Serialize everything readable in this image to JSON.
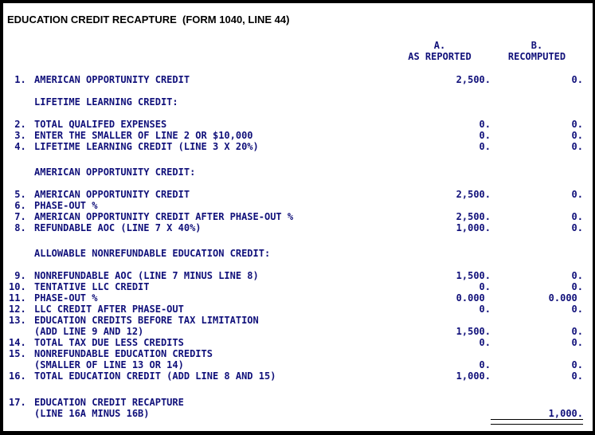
{
  "title": "EDUCATION CREDIT RECAPTURE  (FORM 1040, LINE 44)",
  "columns": {
    "a_letter": "A.",
    "a_label": "AS REPORTED",
    "b_letter": "B.",
    "b_label": "RECOMPUTED"
  },
  "rows": [
    {
      "num": " 1.",
      "label": "AMERICAN OPPORTUNITY CREDIT",
      "a": "2,500.",
      "b": "0."
    },
    {
      "num": "",
      "label": "LIFETIME LEARNING CREDIT:",
      "a": "",
      "b": ""
    },
    {
      "num": " 2.",
      "label": "TOTAL QUALIFED EXPENSES",
      "a": "0.",
      "b": "0."
    },
    {
      "num": " 3.",
      "label": "ENTER THE SMALLER OF LINE 2 OR $10,000",
      "a": "0.",
      "b": "0."
    },
    {
      "num": " 4.",
      "label": "LIFETIME LEARNING CREDIT (LINE 3 X 20%)",
      "a": "0.",
      "b": "0."
    },
    {
      "num": "",
      "label": "AMERICAN OPPORTUNITY CREDIT:",
      "a": "",
      "b": ""
    },
    {
      "num": " 5.",
      "label": "AMERICAN OPPORTUNITY CREDIT",
      "a": "2,500.",
      "b": "0."
    },
    {
      "num": " 6.",
      "label": "PHASE-OUT %",
      "a": "",
      "b": ""
    },
    {
      "num": " 7.",
      "label": "AMERICAN OPPORTUNITY CREDIT AFTER PHASE-OUT %",
      "a": "2,500.",
      "b": "0."
    },
    {
      "num": " 8.",
      "label": "REFUNDABLE AOC (LINE 7 X 40%)",
      "a": "1,000.",
      "b": "0."
    },
    {
      "num": "",
      "label": "ALLOWABLE NONREFUNDABLE EDUCATION CREDIT:",
      "a": "",
      "b": ""
    },
    {
      "num": " 9.",
      "label": "NONREFUNDABLE AOC (LINE 7 MINUS LINE 8)",
      "a": "1,500.",
      "b": "0."
    },
    {
      "num": "10.",
      "label": "TENTATIVE LLC CREDIT",
      "a": "0.",
      "b": "0."
    },
    {
      "num": "11.",
      "label": "PHASE-OUT %",
      "a": "0.000 ",
      "b": "0.000 "
    },
    {
      "num": "12.",
      "label": "LLC CREDIT AFTER PHASE-OUT",
      "a": "0.",
      "b": "0."
    },
    {
      "num": "13.",
      "label": "EDUCATION CREDITS BEFORE TAX LIMITATION",
      "a": "",
      "b": ""
    },
    {
      "num": "",
      "label": "(ADD LINE 9 AND 12)",
      "a": "1,500.",
      "b": "0."
    },
    {
      "num": "14.",
      "label": "TOTAL TAX DUE LESS CREDITS",
      "a": "0.",
      "b": "0."
    },
    {
      "num": "15.",
      "label": "NONREFUNDABLE EDUCATION CREDITS",
      "a": "",
      "b": ""
    },
    {
      "num": "",
      "label": "(SMALLER OF LINE 13 OR 14)",
      "a": "0.",
      "b": "0."
    },
    {
      "num": "16.",
      "label": "TOTAL EDUCATION CREDIT (ADD LINE 8 AND 15)",
      "a": "1,000.",
      "b": "0."
    },
    {
      "num": "17.",
      "label": "EDUCATION CREDIT RECAPTURE",
      "a": "",
      "b": ""
    },
    {
      "num": "",
      "label": "(LINE 16A MINUS 16B)",
      "a": "",
      "b": "1,000."
    }
  ]
}
